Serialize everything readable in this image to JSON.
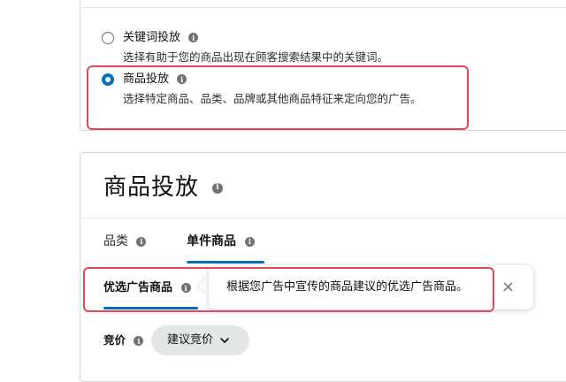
{
  "targeting_options": {
    "keyword": {
      "title": "关键词投放",
      "description": "选择有助于您的商品出现在顾客搜索结果中的关键词。",
      "selected": false
    },
    "product": {
      "title": "商品投放",
      "description": "选择特定商品、品类、品牌或其他商品特征来定向您的广告。",
      "selected": true
    }
  },
  "product_targeting": {
    "title": "商品投放",
    "tabs": [
      {
        "label": "品类",
        "active": false
      },
      {
        "label": "单件商品",
        "active": true
      }
    ],
    "subtab": {
      "label": "优选广告商品",
      "active": true
    },
    "tooltip": {
      "text": "根据您广告中宣传的商品建议的优选广告商品。",
      "close_glyph": "×"
    },
    "bid": {
      "label": "竞价",
      "dropdown_value": "建议竞价"
    }
  },
  "icons": {
    "info": "i",
    "chevron": "⌄"
  },
  "colors": {
    "accent": "#0a6ebd",
    "highlight": "#e0485a",
    "border": "#d5d9d9",
    "text": "#0f1111"
  }
}
